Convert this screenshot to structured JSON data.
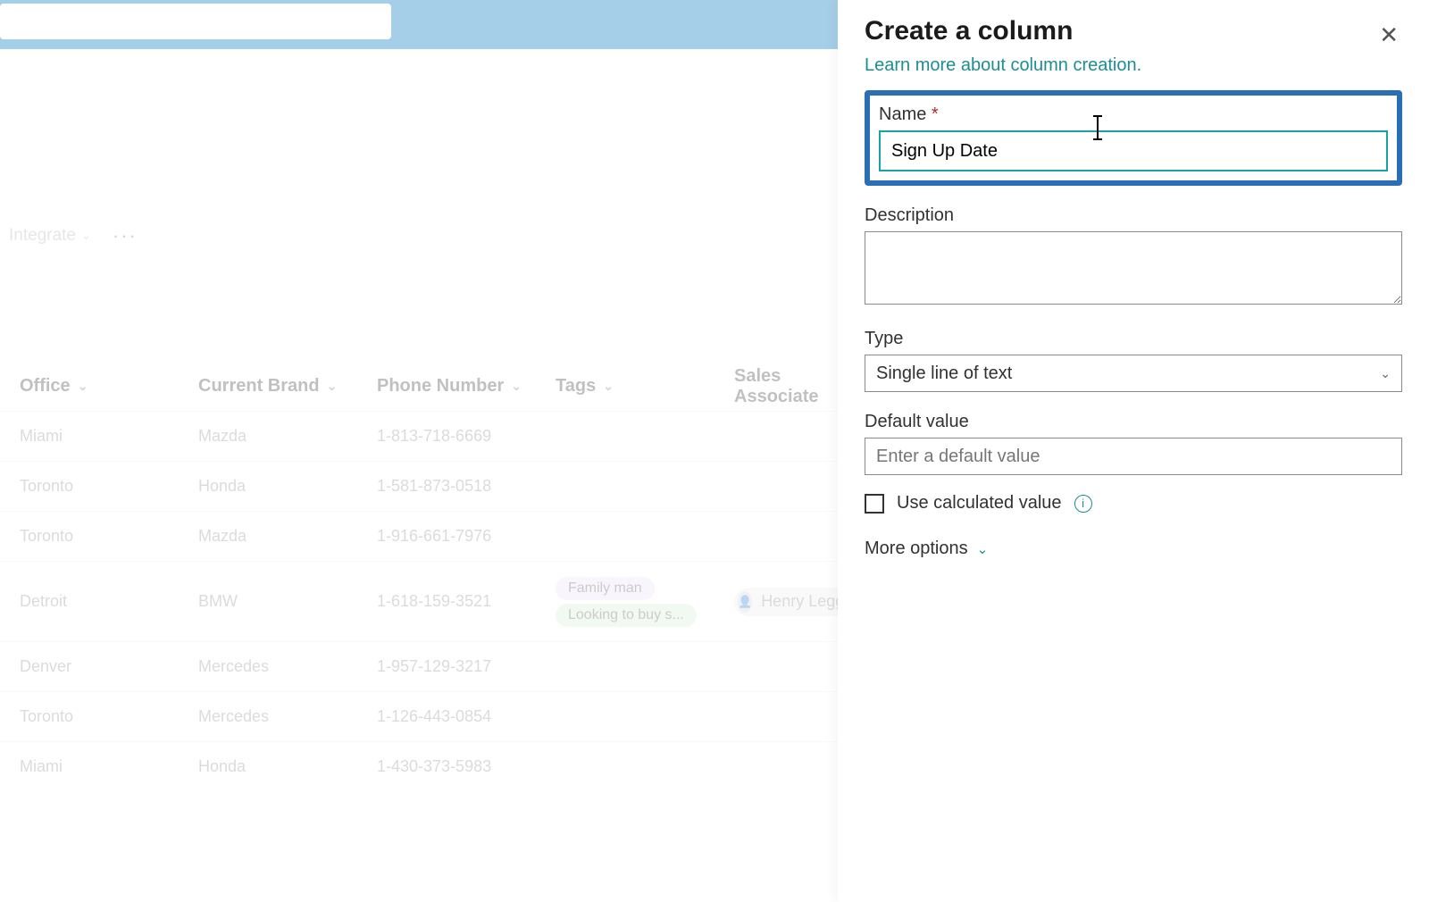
{
  "topbar": {},
  "commandbar": {
    "integrate": "Integrate"
  },
  "columns": {
    "office": "Office",
    "brand": "Current Brand",
    "phone": "Phone Number",
    "tags": "Tags",
    "sales": "Sales Associate"
  },
  "rows": [
    {
      "office": "Miami",
      "brand": "Mazda",
      "phone": "1-813-718-6669",
      "tags": [],
      "sales": ""
    },
    {
      "office": "Toronto",
      "brand": "Honda",
      "phone": "1-581-873-0518",
      "tags": [],
      "sales": ""
    },
    {
      "office": "Toronto",
      "brand": "Mazda",
      "phone": "1-916-661-7976",
      "tags": [],
      "sales": ""
    },
    {
      "office": "Detroit",
      "brand": "BMW",
      "phone": "1-618-159-3521",
      "tags": [
        "Family man",
        "Looking to buy s..."
      ],
      "sales": "Henry Legge"
    },
    {
      "office": "Denver",
      "brand": "Mercedes",
      "phone": "1-957-129-3217",
      "tags": [],
      "sales": ""
    },
    {
      "office": "Toronto",
      "brand": "Mercedes",
      "phone": "1-126-443-0854",
      "tags": [],
      "sales": ""
    },
    {
      "office": "Miami",
      "brand": "Honda",
      "phone": "1-430-373-5983",
      "tags": [],
      "sales": ""
    }
  ],
  "panel": {
    "title": "Create a column",
    "learn": "Learn more about column creation.",
    "name_label": "Name",
    "name_value": "Sign Up Date",
    "desc_label": "Description",
    "type_label": "Type",
    "type_value": "Single line of text",
    "default_label": "Default value",
    "default_placeholder": "Enter a default value",
    "calc_label": "Use calculated value",
    "more_label": "More options"
  }
}
